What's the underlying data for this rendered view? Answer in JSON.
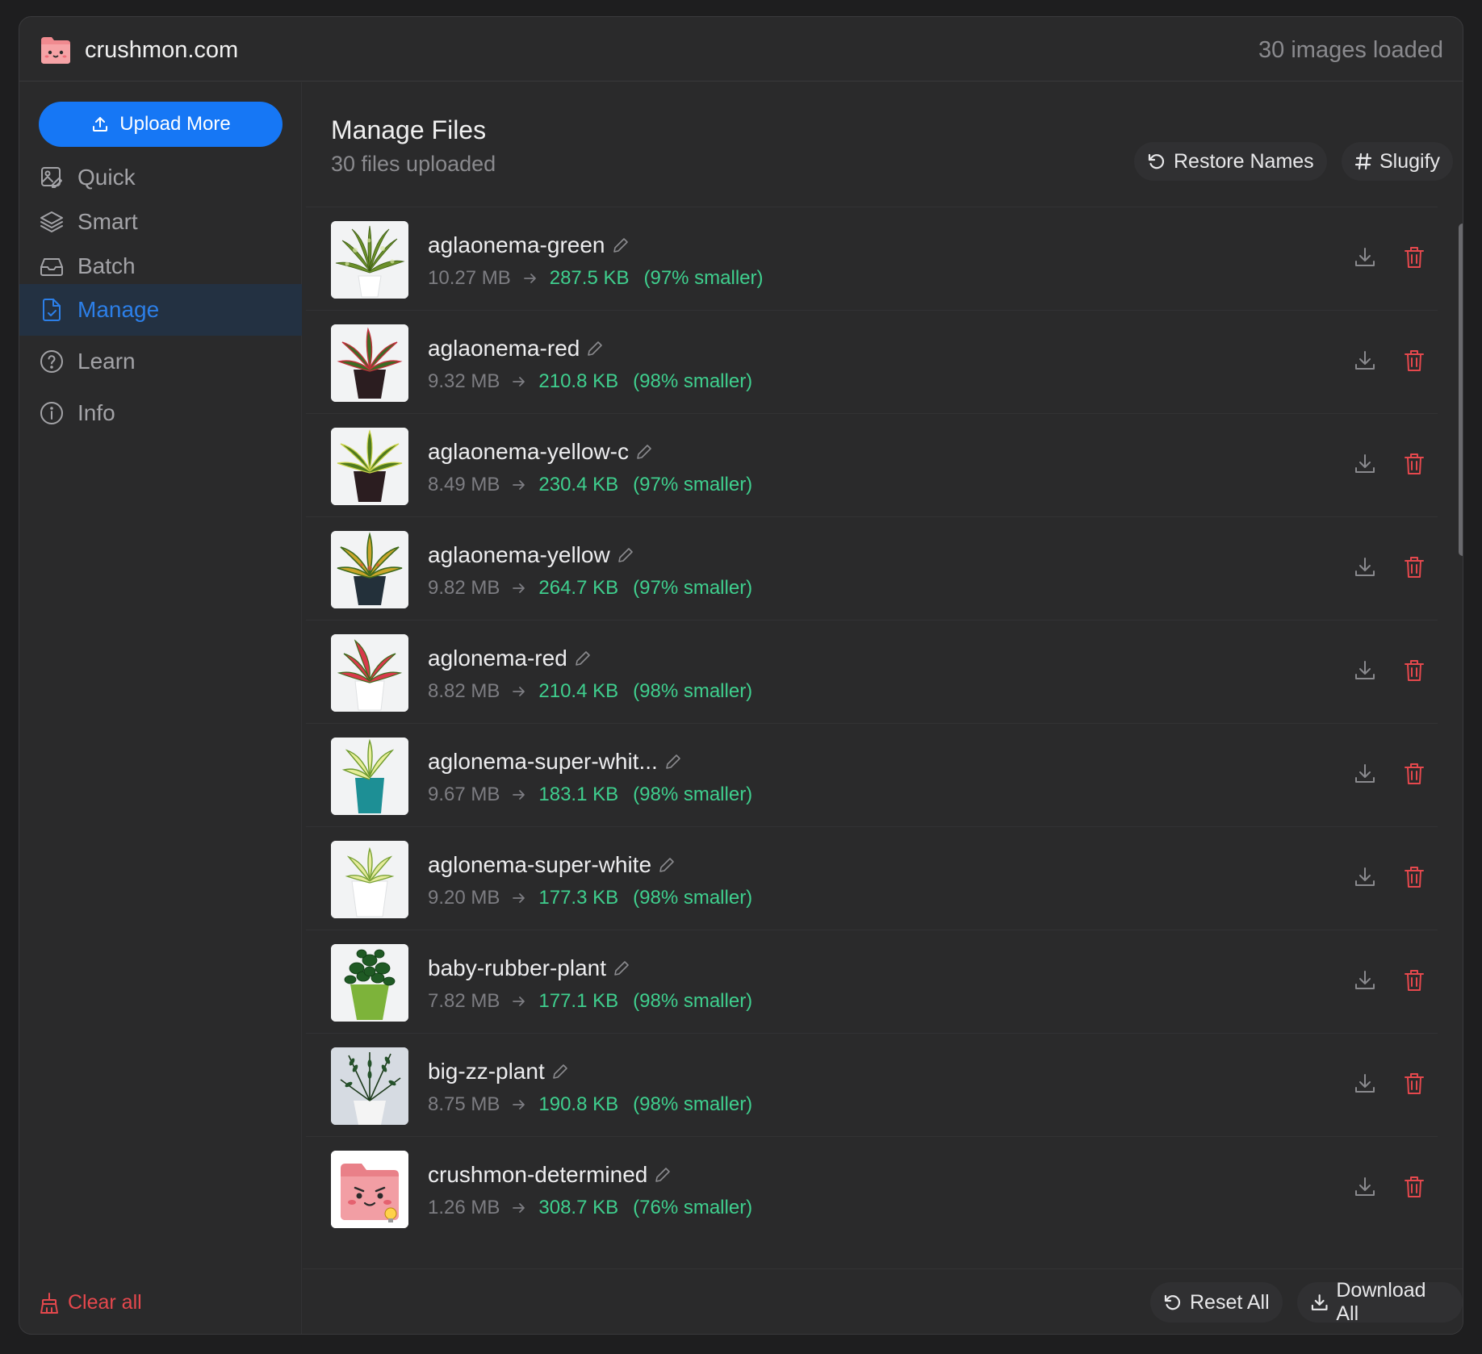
{
  "app": {
    "name": "crushmon.com",
    "images_loaded": "30 images loaded"
  },
  "sidebar": {
    "upload_label": "Upload More",
    "items": [
      {
        "label": "Quick",
        "icon": "image-edit-icon",
        "active": false
      },
      {
        "label": "Smart",
        "icon": "layers-icon",
        "active": false
      },
      {
        "label": "Batch",
        "icon": "inbox-icon",
        "active": false
      },
      {
        "label": "Manage",
        "icon": "file-manage-icon",
        "active": true
      },
      {
        "label": "Learn",
        "icon": "help-circle-icon",
        "active": false
      },
      {
        "label": "Info",
        "icon": "info-icon",
        "active": false
      }
    ],
    "clear_all_label": "Clear all"
  },
  "main": {
    "title": "Manage Files",
    "subtitle": "30 files uploaded",
    "restore_label": "Restore Names",
    "slugify_label": "Slugify"
  },
  "files": [
    {
      "name": "aglaonema-green",
      "original": "10.27 MB",
      "compressed": "287.5 KB",
      "savings": "(97% smaller)"
    },
    {
      "name": "aglaonema-red",
      "original": "9.32 MB",
      "compressed": "210.8 KB",
      "savings": "(98% smaller)"
    },
    {
      "name": "aglaonema-yellow-c",
      "original": "8.49 MB",
      "compressed": "230.4 KB",
      "savings": "(97% smaller)"
    },
    {
      "name": "aglaonema-yellow",
      "original": "9.82 MB",
      "compressed": "264.7 KB",
      "savings": "(97% smaller)"
    },
    {
      "name": "aglonema-red",
      "original": "8.82 MB",
      "compressed": "210.4 KB",
      "savings": "(98% smaller)"
    },
    {
      "name": "aglonema-super-whit...",
      "original": "9.67 MB",
      "compressed": "183.1 KB",
      "savings": "(98% smaller)"
    },
    {
      "name": "aglonema-super-white",
      "original": "9.20 MB",
      "compressed": "177.3 KB",
      "savings": "(98% smaller)"
    },
    {
      "name": "baby-rubber-plant",
      "original": "7.82 MB",
      "compressed": "177.1 KB",
      "savings": "(98% smaller)"
    },
    {
      "name": "big-zz-plant",
      "original": "8.75 MB",
      "compressed": "190.8 KB",
      "savings": "(98% smaller)"
    },
    {
      "name": "crushmon-determined",
      "original": "1.26 MB",
      "compressed": "308.7 KB",
      "savings": "(76% smaller)"
    }
  ],
  "footer": {
    "reset_label": "Reset All",
    "download_label": "Download All"
  },
  "colors": {
    "accent": "#1677f5",
    "success": "#3fcf8e",
    "danger": "#e5484d",
    "active_nav_bg": "#233142"
  }
}
